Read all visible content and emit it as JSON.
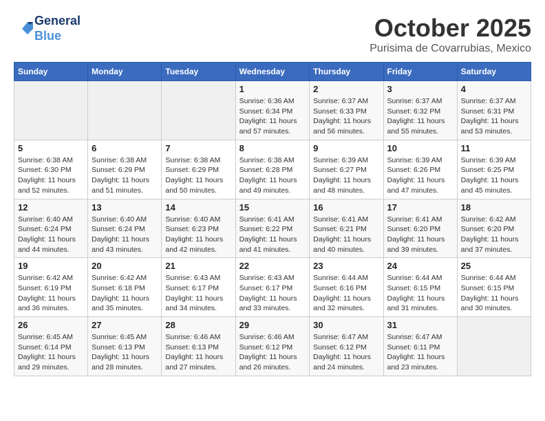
{
  "header": {
    "logo_line1": "General",
    "logo_line2": "Blue",
    "month": "October 2025",
    "location": "Purisima de Covarrubias, Mexico"
  },
  "weekdays": [
    "Sunday",
    "Monday",
    "Tuesday",
    "Wednesday",
    "Thursday",
    "Friday",
    "Saturday"
  ],
  "weeks": [
    [
      {
        "day": "",
        "info": ""
      },
      {
        "day": "",
        "info": ""
      },
      {
        "day": "",
        "info": ""
      },
      {
        "day": "1",
        "info": "Sunrise: 6:36 AM\nSunset: 6:34 PM\nDaylight: 11 hours\nand 57 minutes."
      },
      {
        "day": "2",
        "info": "Sunrise: 6:37 AM\nSunset: 6:33 PM\nDaylight: 11 hours\nand 56 minutes."
      },
      {
        "day": "3",
        "info": "Sunrise: 6:37 AM\nSunset: 6:32 PM\nDaylight: 11 hours\nand 55 minutes."
      },
      {
        "day": "4",
        "info": "Sunrise: 6:37 AM\nSunset: 6:31 PM\nDaylight: 11 hours\nand 53 minutes."
      }
    ],
    [
      {
        "day": "5",
        "info": "Sunrise: 6:38 AM\nSunset: 6:30 PM\nDaylight: 11 hours\nand 52 minutes."
      },
      {
        "day": "6",
        "info": "Sunrise: 6:38 AM\nSunset: 6:29 PM\nDaylight: 11 hours\nand 51 minutes."
      },
      {
        "day": "7",
        "info": "Sunrise: 6:38 AM\nSunset: 6:29 PM\nDaylight: 11 hours\nand 50 minutes."
      },
      {
        "day": "8",
        "info": "Sunrise: 6:38 AM\nSunset: 6:28 PM\nDaylight: 11 hours\nand 49 minutes."
      },
      {
        "day": "9",
        "info": "Sunrise: 6:39 AM\nSunset: 6:27 PM\nDaylight: 11 hours\nand 48 minutes."
      },
      {
        "day": "10",
        "info": "Sunrise: 6:39 AM\nSunset: 6:26 PM\nDaylight: 11 hours\nand 47 minutes."
      },
      {
        "day": "11",
        "info": "Sunrise: 6:39 AM\nSunset: 6:25 PM\nDaylight: 11 hours\nand 45 minutes."
      }
    ],
    [
      {
        "day": "12",
        "info": "Sunrise: 6:40 AM\nSunset: 6:24 PM\nDaylight: 11 hours\nand 44 minutes."
      },
      {
        "day": "13",
        "info": "Sunrise: 6:40 AM\nSunset: 6:24 PM\nDaylight: 11 hours\nand 43 minutes."
      },
      {
        "day": "14",
        "info": "Sunrise: 6:40 AM\nSunset: 6:23 PM\nDaylight: 11 hours\nand 42 minutes."
      },
      {
        "day": "15",
        "info": "Sunrise: 6:41 AM\nSunset: 6:22 PM\nDaylight: 11 hours\nand 41 minutes."
      },
      {
        "day": "16",
        "info": "Sunrise: 6:41 AM\nSunset: 6:21 PM\nDaylight: 11 hours\nand 40 minutes."
      },
      {
        "day": "17",
        "info": "Sunrise: 6:41 AM\nSunset: 6:20 PM\nDaylight: 11 hours\nand 39 minutes."
      },
      {
        "day": "18",
        "info": "Sunrise: 6:42 AM\nSunset: 6:20 PM\nDaylight: 11 hours\nand 37 minutes."
      }
    ],
    [
      {
        "day": "19",
        "info": "Sunrise: 6:42 AM\nSunset: 6:19 PM\nDaylight: 11 hours\nand 36 minutes."
      },
      {
        "day": "20",
        "info": "Sunrise: 6:42 AM\nSunset: 6:18 PM\nDaylight: 11 hours\nand 35 minutes."
      },
      {
        "day": "21",
        "info": "Sunrise: 6:43 AM\nSunset: 6:17 PM\nDaylight: 11 hours\nand 34 minutes."
      },
      {
        "day": "22",
        "info": "Sunrise: 6:43 AM\nSunset: 6:17 PM\nDaylight: 11 hours\nand 33 minutes."
      },
      {
        "day": "23",
        "info": "Sunrise: 6:44 AM\nSunset: 6:16 PM\nDaylight: 11 hours\nand 32 minutes."
      },
      {
        "day": "24",
        "info": "Sunrise: 6:44 AM\nSunset: 6:15 PM\nDaylight: 11 hours\nand 31 minutes."
      },
      {
        "day": "25",
        "info": "Sunrise: 6:44 AM\nSunset: 6:15 PM\nDaylight: 11 hours\nand 30 minutes."
      }
    ],
    [
      {
        "day": "26",
        "info": "Sunrise: 6:45 AM\nSunset: 6:14 PM\nDaylight: 11 hours\nand 29 minutes."
      },
      {
        "day": "27",
        "info": "Sunrise: 6:45 AM\nSunset: 6:13 PM\nDaylight: 11 hours\nand 28 minutes."
      },
      {
        "day": "28",
        "info": "Sunrise: 6:46 AM\nSunset: 6:13 PM\nDaylight: 11 hours\nand 27 minutes."
      },
      {
        "day": "29",
        "info": "Sunrise: 6:46 AM\nSunset: 6:12 PM\nDaylight: 11 hours\nand 26 minutes."
      },
      {
        "day": "30",
        "info": "Sunrise: 6:47 AM\nSunset: 6:12 PM\nDaylight: 11 hours\nand 24 minutes."
      },
      {
        "day": "31",
        "info": "Sunrise: 6:47 AM\nSunset: 6:11 PM\nDaylight: 11 hours\nand 23 minutes."
      },
      {
        "day": "",
        "info": ""
      }
    ]
  ]
}
